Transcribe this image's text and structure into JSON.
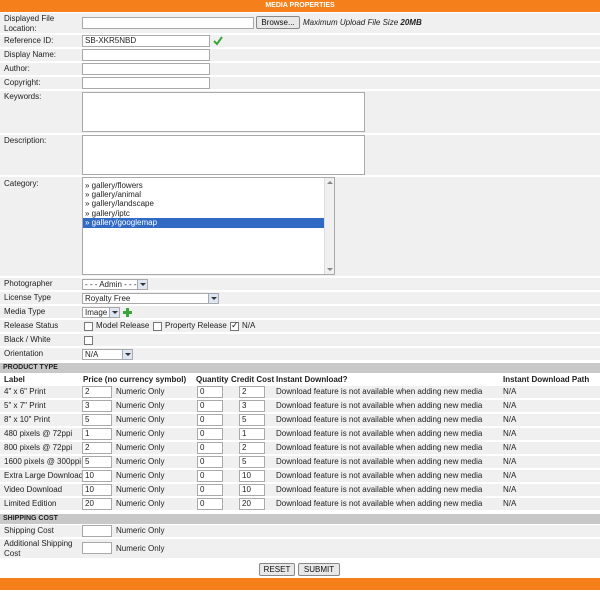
{
  "header": {
    "title": "MEDIA PROPERTIES"
  },
  "file": {
    "label": "Displayed File Location:",
    "browse": "Browse...",
    "max_size_prefix": "Maximum Upload File Size ",
    "max_size_value": "20MB"
  },
  "reference": {
    "label": "Reference ID:",
    "value": "SB-XKR5NBD"
  },
  "display_name": {
    "label": "Display Name:",
    "value": ""
  },
  "author": {
    "label": "Author:",
    "value": ""
  },
  "copyright": {
    "label": "Copyright:",
    "value": ""
  },
  "keywords": {
    "label": "Keywords:"
  },
  "description": {
    "label": "Description:"
  },
  "category": {
    "label": "Category:",
    "items": [
      "» gallery/flowers",
      "» gallery/animal",
      "» gallery/landscape",
      "» gallery/iptc",
      "» gallery/googlemap"
    ],
    "selected_index": 4
  },
  "photographer": {
    "label": "Photographer",
    "value": "- - - Admin - - -"
  },
  "license": {
    "label": "License Type",
    "value": "Royalty Free"
  },
  "media_type": {
    "label": "Media Type",
    "value": "Image"
  },
  "release": {
    "label": "Release Status",
    "model": "Model Release",
    "property": "Property Release",
    "na": "N/A"
  },
  "bw": {
    "label": "Black / White"
  },
  "orientation": {
    "label": "Orientation",
    "value": "N/A"
  },
  "product": {
    "section_title": "PRODUCT TYPE",
    "headers": {
      "label": "Label",
      "price": "Price (no currency symbol)",
      "qty": "Quantity",
      "credit": "Credit Cost",
      "instant": "Instant Download?",
      "path": "Instant Download Path"
    },
    "numeric_only": "Numeric Only",
    "rows": [
      {
        "label": "4\" x 6\" Print",
        "price": "2",
        "qty": "0",
        "credit": "2",
        "instant": "Download feature is not available when adding new media",
        "path": "N/A"
      },
      {
        "label": "5\" x 7\" Print",
        "price": "3",
        "qty": "0",
        "credit": "3",
        "instant": "Download feature is not available when adding new media",
        "path": "N/A"
      },
      {
        "label": "8\" x 10\" Print",
        "price": "5",
        "qty": "0",
        "credit": "5",
        "instant": "Download feature is not available when adding new media",
        "path": "N/A"
      },
      {
        "label": "480 pixels @ 72ppi",
        "price": "1",
        "qty": "0",
        "credit": "1",
        "instant": "Download feature is not available when adding new media",
        "path": "N/A"
      },
      {
        "label": "800 pixels @ 72ppi",
        "price": "2",
        "qty": "0",
        "credit": "2",
        "instant": "Download feature is not available when adding new media",
        "path": "N/A"
      },
      {
        "label": "1600 pixels @ 300ppi",
        "price": "5",
        "qty": "0",
        "credit": "5",
        "instant": "Download feature is not available when adding new media",
        "path": "N/A"
      },
      {
        "label": "Extra Large Download",
        "price": "10",
        "qty": "0",
        "credit": "10",
        "instant": "Download feature is not available when adding new media",
        "path": "N/A"
      },
      {
        "label": "Video Download",
        "price": "10",
        "qty": "0",
        "credit": "10",
        "instant": "Download feature is not available when adding new media",
        "path": "N/A"
      },
      {
        "label": "Limited Edition",
        "price": "20",
        "qty": "0",
        "credit": "20",
        "instant": "Download feature is not available when adding new media",
        "path": "N/A"
      }
    ]
  },
  "shipping": {
    "section_title": "SHIPPING COST",
    "cost_label": "Shipping Cost",
    "additional_label": "Additional Shipping Cost",
    "numeric_only": "Numeric Only"
  },
  "buttons": {
    "reset": "RESET",
    "submit": "SUBMIT"
  },
  "colors": {
    "accent": "#f57f1a",
    "row_bg": "#f0f0f0",
    "section_bg": "#c8c8c8",
    "selected": "#316ac5",
    "check_green": "#3aa63a"
  }
}
